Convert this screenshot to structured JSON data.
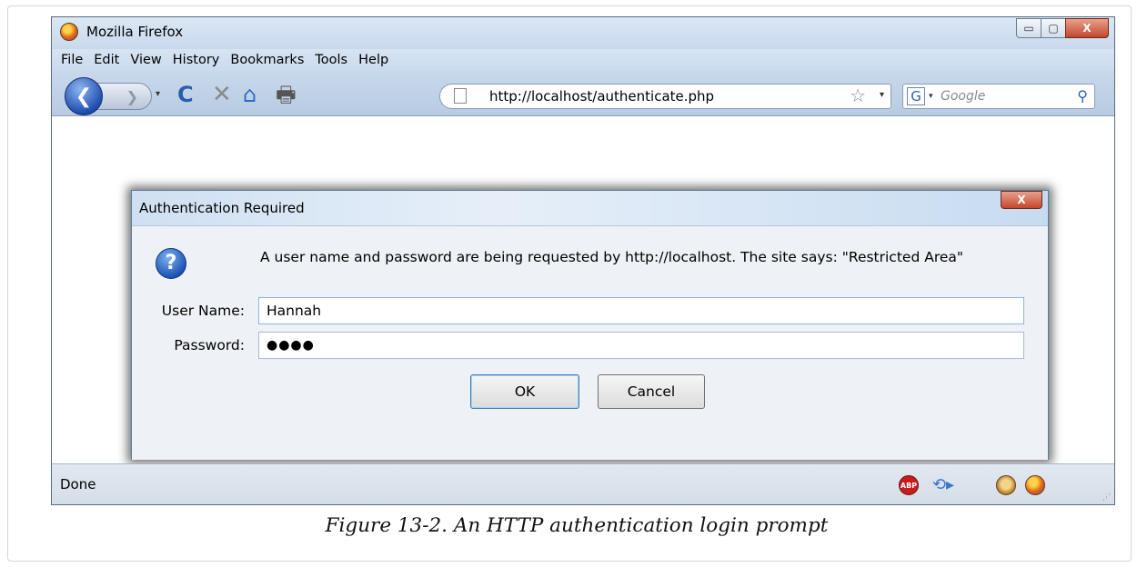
{
  "window": {
    "title": "Mozilla Firefox",
    "minimize_glyph": "▭",
    "maximize_glyph": "▢",
    "close_glyph": "X"
  },
  "menu": {
    "items": [
      "File",
      "Edit",
      "View",
      "History",
      "Bookmarks",
      "Tools",
      "Help"
    ]
  },
  "toolbar": {
    "back_glyph": "❮",
    "forward_glyph": "❯",
    "dropdown_glyph": "▾",
    "reload_glyph": "C",
    "stop_glyph": "✕",
    "home_glyph": "⌂",
    "print_glyph": "🖶",
    "url": "http://localhost/authenticate.php",
    "star_glyph": "☆",
    "search_engine_glyph": "G",
    "search_placeholder": "Google",
    "search_glyph": "⚲"
  },
  "dialog": {
    "title": "Authentication Required",
    "close_glyph": "X",
    "question_glyph": "?",
    "message": "A user name and password are being requested by http://localhost. The site says: \"Restricted Area\"",
    "username_label": "User Name:",
    "username_value": "Hannah",
    "password_label": "Password:",
    "password_value": "●●●●",
    "ok_label": "OK",
    "cancel_label": "Cancel"
  },
  "statusbar": {
    "text": "Done",
    "abp_text": "ABP",
    "sync_glyph": "⟲▸",
    "grip_glyph": "⋰"
  },
  "caption": "Figure 13-2. An HTTP authentication login prompt",
  "colors": {
    "titlebar": "#dbe7f4",
    "navbar": "#c9d9ec",
    "dialog_bg": "#eef1f5",
    "close_button": "#c5472d",
    "back_button": "#1f4fb0"
  }
}
